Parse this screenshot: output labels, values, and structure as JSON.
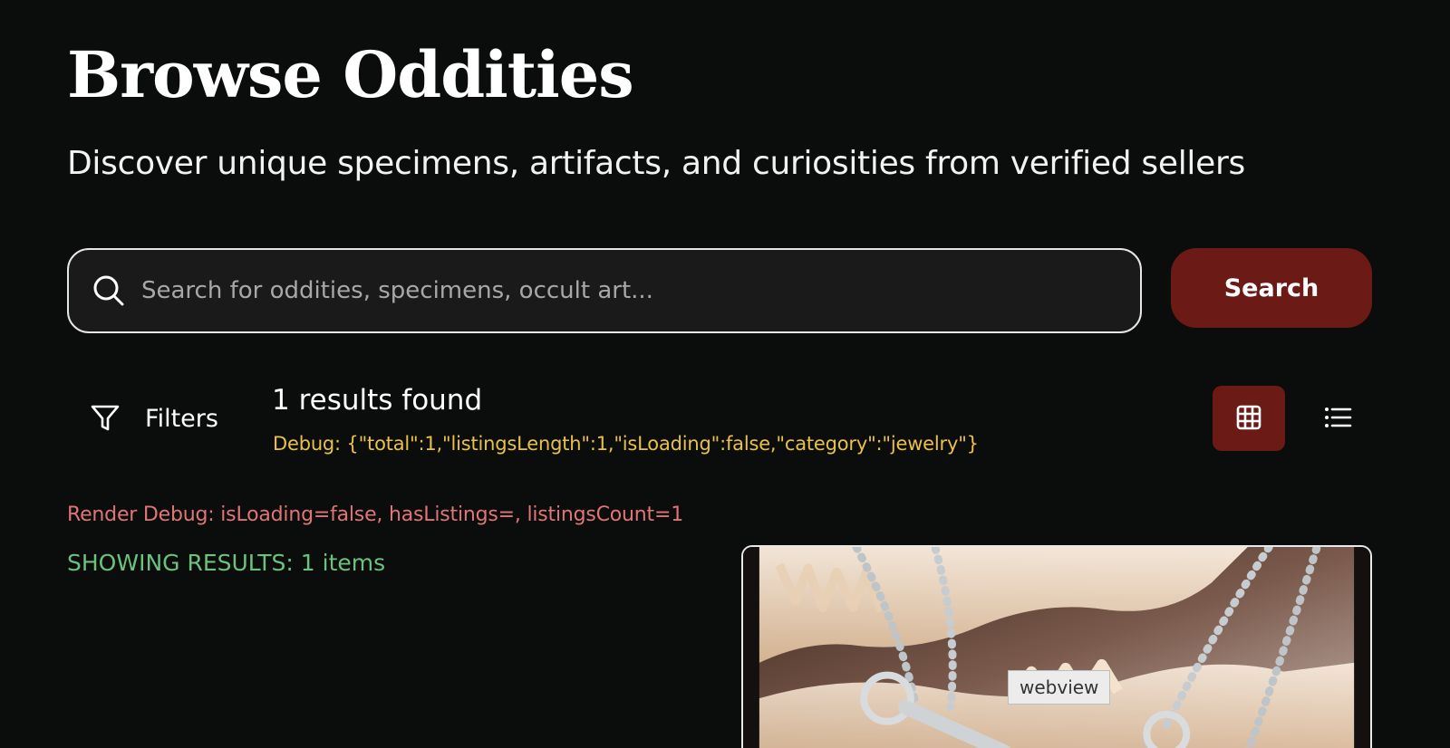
{
  "header": {
    "title": "Browse Oddities",
    "subtitle": "Discover unique specimens, artifacts, and curiosities from verified sellers"
  },
  "search": {
    "placeholder": "Search for oddities, specimens, occult art...",
    "value": "",
    "button_label": "Search",
    "icon": "search-icon"
  },
  "toolbar": {
    "filters_label": "Filters",
    "filters_icon": "filter-icon",
    "results_count": "1 results found",
    "debug": "Debug: {\"total\":1,\"listingsLength\":1,\"isLoading\":false,\"category\":\"jewelry\"}",
    "view_modes": [
      {
        "name": "grid",
        "icon": "grid-icon",
        "active": true
      },
      {
        "name": "list",
        "icon": "list-icon",
        "active": false
      }
    ]
  },
  "results": {
    "render_debug": "Render Debug: isLoading=false, hasListings=, listingsCount=1",
    "showing": "SHOWING RESULTS: 1 items"
  },
  "tooltip": {
    "label": "webview"
  },
  "colors": {
    "background": "#0b0c0c",
    "accent": "#6c1a16",
    "debug_yellow": "#e9c245",
    "debug_red": "#e07575",
    "success_green": "#6cc27d"
  }
}
